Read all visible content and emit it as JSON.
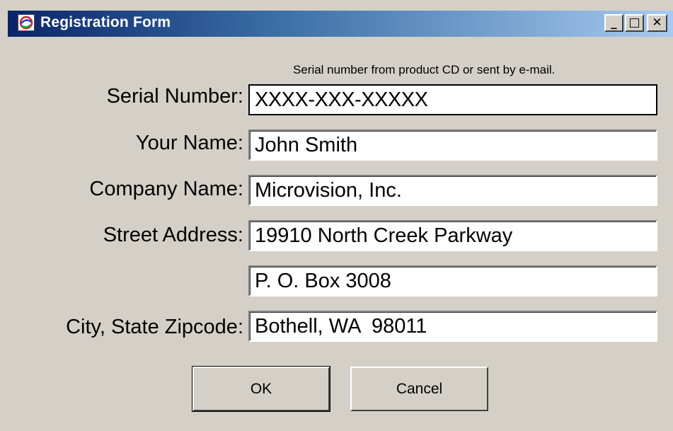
{
  "window": {
    "title": "Registration Form",
    "controls": {
      "minimize": "_",
      "maximize": "□",
      "close": "✕"
    }
  },
  "form": {
    "serial_hint": "Serial number from product CD or sent by e-mail.",
    "fields": [
      {
        "label": "Serial Number:",
        "value": "XXXX-XXX-XXXXX"
      },
      {
        "label": "Your Name:",
        "value": "John Smith"
      },
      {
        "label": "Company Name:",
        "value": "Microvision, Inc."
      },
      {
        "label": "Street Address:",
        "value": "19910 North Creek Parkway"
      },
      {
        "label": "",
        "value": "P. O. Box 3008"
      },
      {
        "label": "City, State Zipcode:",
        "value": "Bothell, WA  98011"
      }
    ]
  },
  "buttons": {
    "ok": "OK",
    "cancel": "Cancel"
  }
}
